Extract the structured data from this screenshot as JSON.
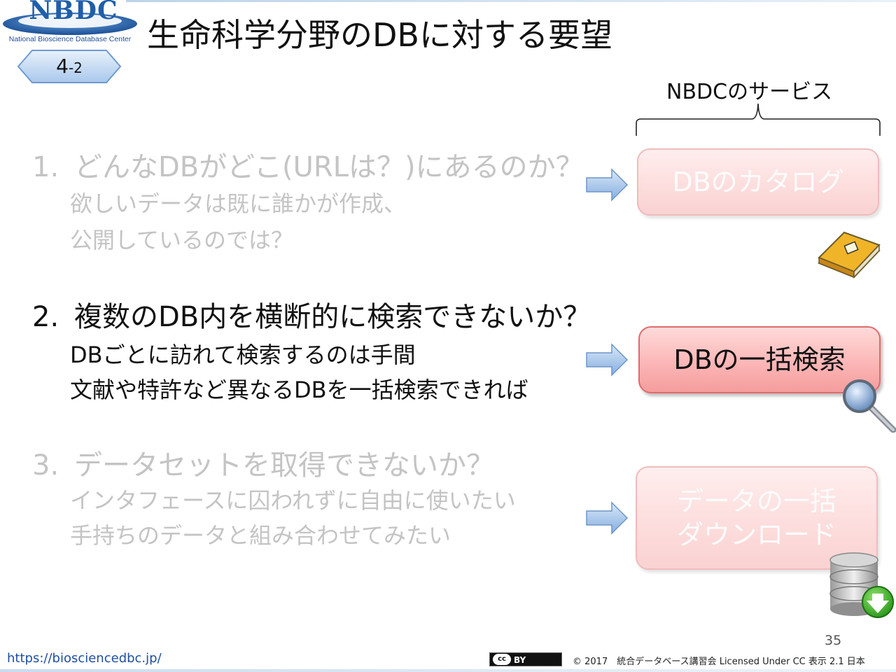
{
  "logo": {
    "name": "NBDC",
    "subtitle": "National Bioscience Database Center"
  },
  "title": "生命科学分野のDBに対する要望",
  "badge": {
    "main": "4",
    "sub": "-2"
  },
  "services_label": "NBDCのサービス",
  "items": [
    {
      "number": "1.",
      "heading": "どんなDBがどこ(URLは？)にあるのか？",
      "lines": [
        "欲しいデータは既に誰かが作成、",
        "公開しているのでは？"
      ],
      "service": "DBのカタログ",
      "state": "faded"
    },
    {
      "number": "2.",
      "heading": "複数のDB内を横断的に検索できないか？",
      "lines": [
        "DBごとに訪れて検索するのは手間",
        "文献や特許など異なるDBを一括検索できれば"
      ],
      "service": "DBの一括検索",
      "state": "active"
    },
    {
      "number": "3.",
      "heading": "データセットを取得できないか？",
      "lines": [
        "インタフェースに囚われずに自由に使いたい",
        "手持ちのデータと組み合わせてみたい"
      ],
      "service": "データの一括\nダウンロード",
      "state": "faded"
    }
  ],
  "icons": [
    "book-icon",
    "magnifier-icon",
    "database-download-icon",
    "right-arrow-icon"
  ],
  "footer": {
    "page_number": "35",
    "url": "https://biosciencedbc.jp/",
    "cc_badge": "BY",
    "cc_mark": "cc",
    "copyright": "© 2017　統合データベース講習会 Licensed Under CC 表示 2.1 日本"
  },
  "colors": {
    "logo_blue": "#1f5fa8",
    "service_box_fill": "#fbb3b3",
    "service_box_border": "#e06b6b",
    "arrow_fill": "#9ec1ea",
    "faded_text": "#c4c4c4"
  }
}
